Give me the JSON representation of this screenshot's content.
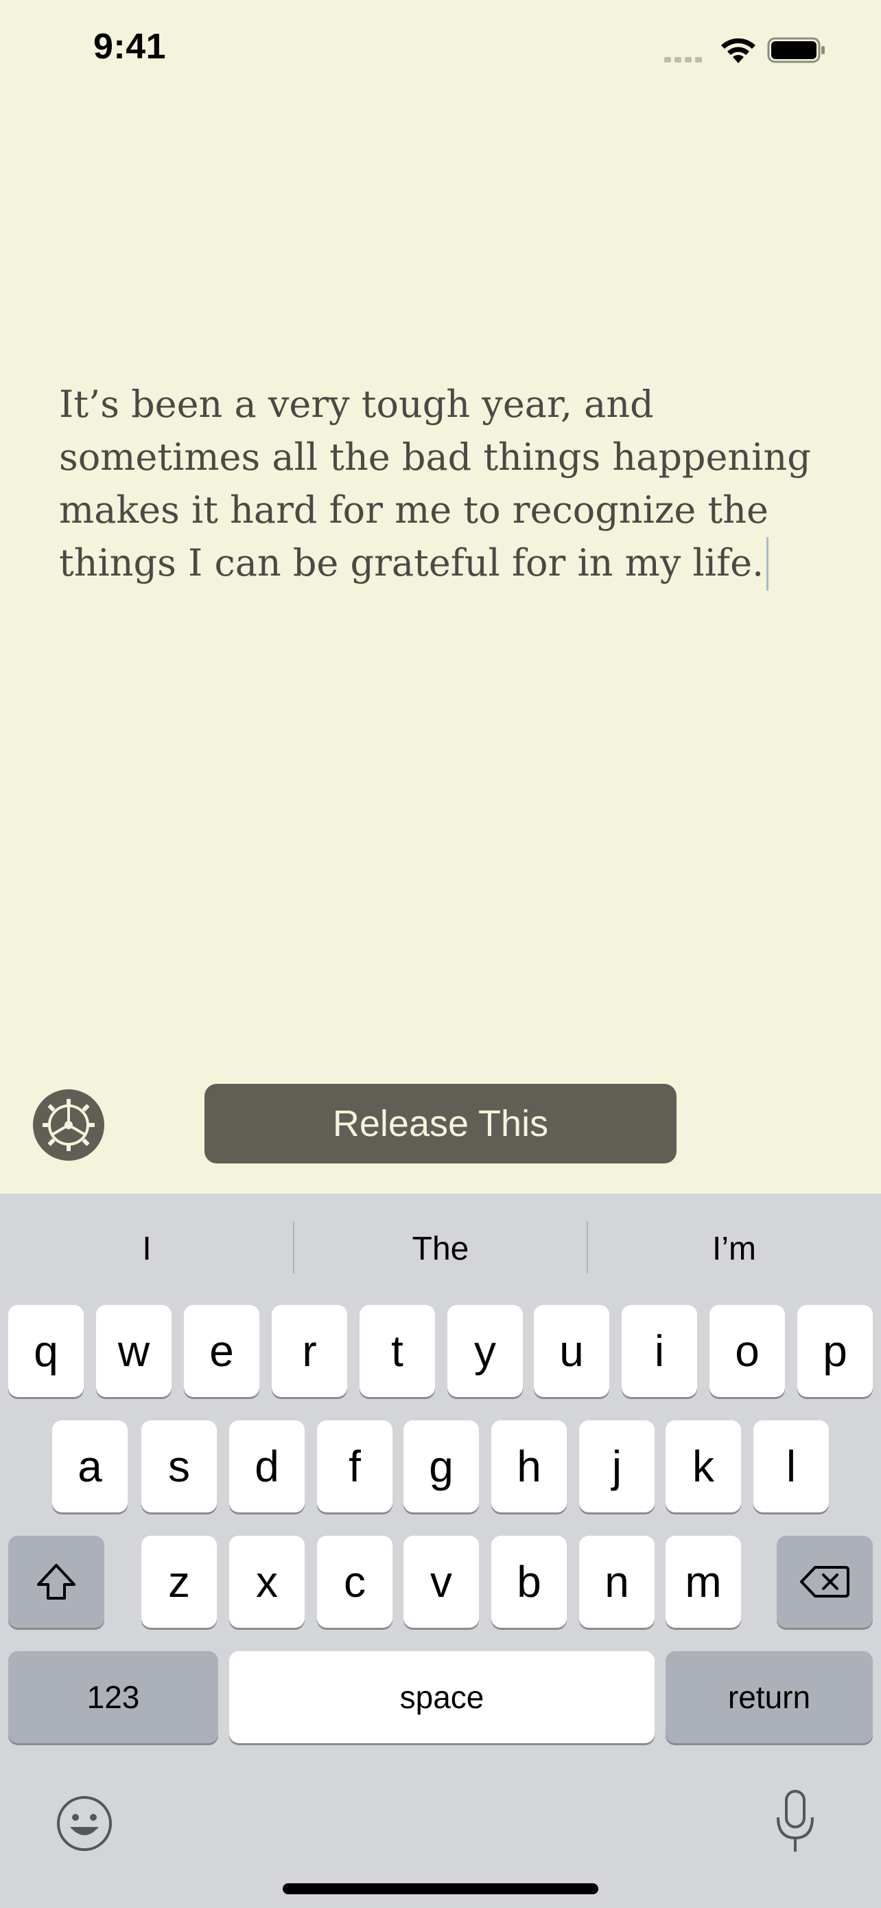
{
  "status_bar": {
    "time": "9:41"
  },
  "journal": {
    "text": "It’s been a very tough year, and sometimes all the bad things happening makes it hard for me to recognize the things I can be grateful for in my life."
  },
  "actions": {
    "release_label": "Release This"
  },
  "keyboard": {
    "suggestions": [
      "I",
      "The",
      "I’m"
    ],
    "row1": [
      "q",
      "w",
      "e",
      "r",
      "t",
      "y",
      "u",
      "i",
      "o",
      "p"
    ],
    "row2": [
      "a",
      "s",
      "d",
      "f",
      "g",
      "h",
      "j",
      "k",
      "l"
    ],
    "row3": [
      "z",
      "x",
      "c",
      "v",
      "b",
      "n",
      "m"
    ],
    "numbers_label": "123",
    "space_label": "space",
    "return_label": "return"
  },
  "colors": {
    "background": "#f4f4dc",
    "button": "#5f5f55",
    "button_text": "#f4f4dc"
  },
  "icons": {
    "settings": "gear-icon",
    "shift": "shift-icon",
    "delete": "delete-icon",
    "emoji": "emoji-icon",
    "mic": "microphone-icon"
  }
}
